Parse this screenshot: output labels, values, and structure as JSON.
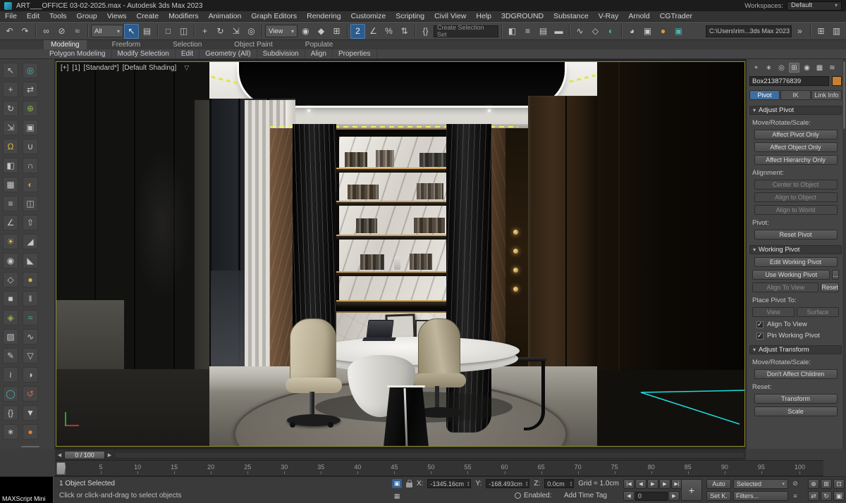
{
  "titlebar": {
    "title": "ART___OFFICE 03-02-2025.max - Autodesk 3ds Max 2023",
    "workspaces_label": "Workspaces:",
    "workspace_value": "Default"
  },
  "menu": {
    "items": [
      "File",
      "Edit",
      "Tools",
      "Group",
      "Views",
      "Create",
      "Modifiers",
      "Animation",
      "Graph Editors",
      "Rendering",
      "Customize",
      "Scripting",
      "Civil View",
      "Help",
      "3DGROUND",
      "Substance",
      "V-Ray",
      "Arnold",
      "CGTrader"
    ]
  },
  "toolbar": {
    "items": [
      {
        "type": "icon",
        "name": "undo-icon",
        "glyph": "↶"
      },
      {
        "type": "icon",
        "name": "redo-icon",
        "glyph": "↷"
      },
      {
        "type": "sep"
      },
      {
        "type": "icon",
        "name": "select-and-link-icon",
        "glyph": "∞"
      },
      {
        "type": "icon",
        "name": "unlink-selection-icon",
        "glyph": "⊘"
      },
      {
        "type": "icon",
        "name": "bind-to-space-warp-icon",
        "glyph": "≈"
      },
      {
        "type": "sep"
      },
      {
        "type": "dropdown",
        "name": "selection-filter-dropdown",
        "value": "All"
      },
      {
        "type": "icon",
        "name": "select-object-icon",
        "glyph": "↖",
        "active": true
      },
      {
        "type": "icon",
        "name": "select-by-name-icon",
        "glyph": "▤"
      },
      {
        "type": "sep"
      },
      {
        "type": "icon",
        "name": "rectangular-selection-region-icon",
        "glyph": "□"
      },
      {
        "type": "icon",
        "name": "window-crossing-icon",
        "glyph": "◫"
      },
      {
        "type": "sep"
      },
      {
        "type": "icon",
        "name": "select-and-move-icon",
        "glyph": "+"
      },
      {
        "type": "icon",
        "name": "select-and-rotate-icon",
        "glyph": "↻"
      },
      {
        "type": "icon",
        "name": "select-and-scale-icon",
        "glyph": "⇲"
      },
      {
        "type": "icon",
        "name": "select-and-place-icon",
        "glyph": "◎"
      },
      {
        "type": "sep"
      },
      {
        "type": "dropdown",
        "name": "reference-coordinate-dropdown",
        "value": "View"
      },
      {
        "type": "icon",
        "name": "use-pivot-center-icon",
        "glyph": "◉"
      },
      {
        "type": "icon",
        "name": "select-and-manipulate-icon",
        "glyph": "◆"
      },
      {
        "type": "icon",
        "name": "keyboard-shortcut-override-icon",
        "glyph": "⊞"
      },
      {
        "type": "sep"
      },
      {
        "type": "icon",
        "name": "snaps-toggle-icon",
        "glyph": "2",
        "active": true
      },
      {
        "type": "icon",
        "name": "angle-snap-icon",
        "glyph": "∠"
      },
      {
        "type": "icon",
        "name": "percent-snap-icon",
        "glyph": "%"
      },
      {
        "type": "icon",
        "name": "spinner-snap-icon",
        "glyph": "⇅"
      },
      {
        "type": "sep"
      },
      {
        "type": "icon",
        "name": "edit-named-selections-icon",
        "glyph": "{}"
      },
      {
        "type": "input",
        "name": "named-selection-set-input",
        "placeholder": "Create Selection Set"
      },
      {
        "type": "sep"
      },
      {
        "type": "icon",
        "name": "mirror-icon",
        "glyph": "◧"
      },
      {
        "type": "icon",
        "name": "align-icon",
        "glyph": "≡"
      },
      {
        "type": "icon",
        "name": "layer-explorer-icon",
        "glyph": "▤"
      },
      {
        "type": "icon",
        "name": "ribbon-toggle-icon",
        "glyph": "▬"
      },
      {
        "type": "sep"
      },
      {
        "type": "icon",
        "name": "curve-editor-icon",
        "glyph": "∿"
      },
      {
        "type": "icon",
        "name": "schematic-view-icon",
        "glyph": "◇"
      },
      {
        "type": "icon",
        "name": "material-editor-icon",
        "glyph": "◐",
        "color": "#45b5ae"
      },
      {
        "type": "sep"
      },
      {
        "type": "icon",
        "name": "render-setup-icon",
        "glyph": "◕"
      },
      {
        "type": "icon",
        "name": "rendered-frame-window-icon",
        "glyph": "▣"
      },
      {
        "type": "icon",
        "name": "render-production-icon",
        "glyph": "●",
        "color": "#e2953f"
      },
      {
        "type": "icon",
        "name": "vray-framebuffer-icon",
        "glyph": "▣",
        "color": "#45b5ae"
      },
      {
        "type": "spacer"
      },
      {
        "type": "path",
        "name": "project-folder-field",
        "value": "C:\\Users\\rim...3ds Max 2023"
      },
      {
        "type": "icon",
        "name": "toolbar-overflow-icon",
        "glyph": "»"
      },
      {
        "type": "sep"
      },
      {
        "type": "icon",
        "name": "viewport-layout-icon",
        "glyph": "⊞"
      },
      {
        "type": "icon",
        "name": "docking-icon",
        "glyph": "▥"
      }
    ]
  },
  "ribbon": {
    "tabs": [
      "Modeling",
      "Freeform",
      "Selection",
      "Object Paint",
      "Populate"
    ],
    "active_tab": "Modeling",
    "subitems": [
      "Polygon Modeling",
      "Modify Selection",
      "Edit",
      "Geometry (All)",
      "Subdivision",
      "Align",
      "Properties"
    ]
  },
  "left_toolbar": {
    "col1": [
      {
        "name": "select-tool-icon",
        "glyph": "↖",
        "color": "#c6c6c6"
      },
      {
        "name": "move-tool-icon",
        "glyph": "+",
        "color": "#c6c6c6"
      },
      {
        "name": "rotate-tool-icon",
        "glyph": "↻",
        "color": "#c6c6c6"
      },
      {
        "name": "scale-tool-icon",
        "glyph": "⇲",
        "color": "#c6c6c6"
      },
      {
        "name": "snap-tool-icon",
        "glyph": "Ω",
        "color": "#d8b54a"
      },
      {
        "name": "mirror-tool-icon",
        "glyph": "◧",
        "color": "#c6c6c6"
      },
      {
        "name": "array-tool-icon",
        "glyph": "▦",
        "color": "#c6c6c6"
      },
      {
        "name": "align-tool-icon",
        "glyph": "≡",
        "color": "#c6c6c6"
      },
      {
        "name": "measure-tool-icon",
        "glyph": "∠",
        "color": "#c6c6c6"
      },
      {
        "name": "light-tool-icon",
        "glyph": "☀",
        "color": "#e0c050"
      },
      {
        "name": "camera-tool-icon",
        "glyph": "◉",
        "color": "#c6c6c6"
      },
      {
        "name": "shape-tool-icon",
        "glyph": "◇",
        "color": "#c6c6c6"
      },
      {
        "name": "geometry-tool-icon",
        "glyph": "■",
        "color": "#c6c6c6"
      },
      {
        "name": "modifier-tool-icon",
        "glyph": "◈",
        "color": "#8fb34a"
      },
      {
        "name": "uvw-tool-icon",
        "glyph": "▧",
        "color": "#c6c6c6"
      },
      {
        "name": "paint-tool-icon",
        "glyph": "✎",
        "color": "#c6c6c6"
      },
      {
        "name": "bone-tool-icon",
        "glyph": "≀",
        "color": "#c6c6c6"
      },
      {
        "name": "physics-tool-icon",
        "glyph": "◯",
        "color": "#4ab6b0"
      },
      {
        "name": "script-tool-icon",
        "glyph": "{}",
        "color": "#c6c6c6"
      },
      {
        "name": "settings-tool-icon",
        "glyph": "∗",
        "color": "#c6c6c6"
      }
    ],
    "col2": [
      {
        "name": "isolate-tool-icon",
        "glyph": "◎",
        "color": "#4ab6b0"
      },
      {
        "name": "xref-tool-icon",
        "glyph": "⇄",
        "color": "#c6c6c6"
      },
      {
        "name": "merge-tool-icon",
        "glyph": "⊕",
        "color": "#8fb34a"
      },
      {
        "name": "group-tool-icon",
        "glyph": "▣",
        "color": "#c6c6c6"
      },
      {
        "name": "attach-tool-icon",
        "glyph": "∪",
        "color": "#c6c6c6"
      },
      {
        "name": "detach-tool-icon",
        "glyph": "∩",
        "color": "#c6c6c6"
      },
      {
        "name": "boolean-tool-icon",
        "glyph": "◐",
        "color": "#d8944a"
      },
      {
        "name": "slice-tool-icon",
        "glyph": "◫",
        "color": "#c6c6c6"
      },
      {
        "name": "extrude-tool-icon",
        "glyph": "⇧",
        "color": "#c6c6c6"
      },
      {
        "name": "bevel-tool-icon",
        "glyph": "◢",
        "color": "#c6c6c6"
      },
      {
        "name": "chamfer-tool-icon",
        "glyph": "◣",
        "color": "#c6c6c6"
      },
      {
        "name": "weld-tool-icon",
        "glyph": "●",
        "color": "#d8b54a"
      },
      {
        "name": "bridge-tool-icon",
        "glyph": "‖",
        "color": "#c6c6c6"
      },
      {
        "name": "relax-tool-icon",
        "glyph": "≈",
        "color": "#4ab6b0"
      },
      {
        "name": "smooth-tool-icon",
        "glyph": "∿",
        "color": "#c6c6c6"
      },
      {
        "name": "optimize-tool-icon",
        "glyph": "▽",
        "color": "#c6c6c6"
      },
      {
        "name": "symmetry-tool-icon",
        "glyph": "◑",
        "color": "#c6c6c6"
      },
      {
        "name": "reset-xform-tool-icon",
        "glyph": "↺",
        "color": "#d86a4a"
      },
      {
        "name": "collapse-tool-icon",
        "glyph": "▼",
        "color": "#c6c6c6"
      },
      {
        "name": "render-tool-icon",
        "glyph": "●",
        "color": "#e08030"
      }
    ],
    "big_button": {
      "name": "left-tool-big-button",
      "glyph": ""
    }
  },
  "viewport": {
    "label_segments": [
      "[+]",
      "[1]",
      "[Standard*]",
      "[Default Shading]"
    ],
    "filter_icon": "▽"
  },
  "command_panel": {
    "top_icons": [
      {
        "name": "add-rollout-icon",
        "glyph": "+"
      },
      {
        "name": "create-tab-icon",
        "glyph": "∗"
      },
      {
        "name": "modify-tab-icon",
        "glyph": "◎"
      },
      {
        "name": "hierarchy-tab-icon",
        "glyph": "⊞",
        "active": true
      },
      {
        "name": "motion-tab-icon",
        "glyph": "◉"
      },
      {
        "name": "display-tab-icon",
        "glyph": "▦"
      },
      {
        "name": "utilities-tab-icon",
        "glyph": "≋"
      }
    ],
    "object_name": "Box2138776839",
    "tabs": [
      "Pivot",
      "IK",
      "Link Info"
    ],
    "active_tab": "Pivot",
    "adjust_pivot": {
      "title": "Adjust Pivot",
      "move_label": "Move/Rotate/Scale:",
      "affect_pivot": "Affect Pivot Only",
      "affect_object": "Affect Object Only",
      "affect_hierarchy": "Affect Hierarchy Only",
      "alignment_label": "Alignment:",
      "center_to_object": "Center to Object",
      "align_to_object": "Align to Object",
      "align_to_world": "Align to World",
      "pivot_label": "Pivot:",
      "reset_pivot": "Reset Pivot"
    },
    "working_pivot": {
      "title": "Working Pivot",
      "edit_working_pivot": "Edit Working Pivot",
      "use_working_pivot": "Use Working Pivot",
      "use_more": "...",
      "align_to_view_btn": "Align To View",
      "reset_btn": "Reset",
      "place_label": "Place Pivot To:",
      "view_btn": "View",
      "surface_btn": "Surface",
      "check_align": "Align To View",
      "check_pin": "Pin Working Pivot"
    },
    "adjust_transform": {
      "title": "Adjust Transform",
      "move_label": "Move/Rotate/Scale:",
      "dont_affect_children": "Don't Affect Children",
      "reset_label": "Reset:",
      "transform_btn": "Transform",
      "scale_btn": "Scale"
    }
  },
  "timeline": {
    "handle": "0 / 100",
    "ticks": [
      "0",
      "5",
      "10",
      "15",
      "20",
      "25",
      "30",
      "35",
      "40",
      "45",
      "50",
      "55",
      "60",
      "65",
      "70",
      "75",
      "80",
      "85",
      "90",
      "95",
      "100"
    ]
  },
  "status": {
    "selection": "1 Object Selected",
    "prompt": "Click or click-and-drag to select objects",
    "maxscript_label": "MAXScript Mini",
    "isolate_icon": "▣",
    "x_label": "X:",
    "x_value": "-1345.16cm",
    "y_label": "Y:",
    "y_value": "-168.493cm",
    "z_label": "Z:",
    "z_value": "0.0cm",
    "grid": "Grid = 1.0cm",
    "enabled_label": "Enabled:",
    "add_time_tag": "Add Time Tag",
    "time_value": "0",
    "transport": [
      {
        "name": "go-to-start-button",
        "glyph": "|◀"
      },
      {
        "name": "previous-frame-button",
        "glyph": "◀"
      },
      {
        "name": "play-button",
        "glyph": "▶"
      },
      {
        "name": "next-frame-button",
        "glyph": "▶"
      },
      {
        "name": "go-to-end-button",
        "glyph": "▶|"
      }
    ],
    "set_keys_glyph": "+",
    "auto_key": "Auto",
    "selected_dd": "Selected",
    "set_key": "Set K.",
    "filters": "Filters...",
    "extra_row1": [
      {
        "name": "mute-keys-icon",
        "glyph": "⊘"
      }
    ],
    "extra_row2": [
      {
        "name": "key-filter-icon",
        "glyph": "≡"
      }
    ],
    "nav_row1": [
      {
        "name": "zoom-icon",
        "glyph": "⊕"
      },
      {
        "name": "zoom-all-icon",
        "glyph": "⊞"
      },
      {
        "name": "zoom-extents-icon",
        "glyph": "⊡"
      }
    ],
    "nav_row2": [
      {
        "name": "pan-icon",
        "glyph": "⇄"
      },
      {
        "name": "orbit-icon",
        "glyph": "↻"
      },
      {
        "name": "maximize-viewport-icon",
        "glyph": "▣"
      }
    ]
  }
}
